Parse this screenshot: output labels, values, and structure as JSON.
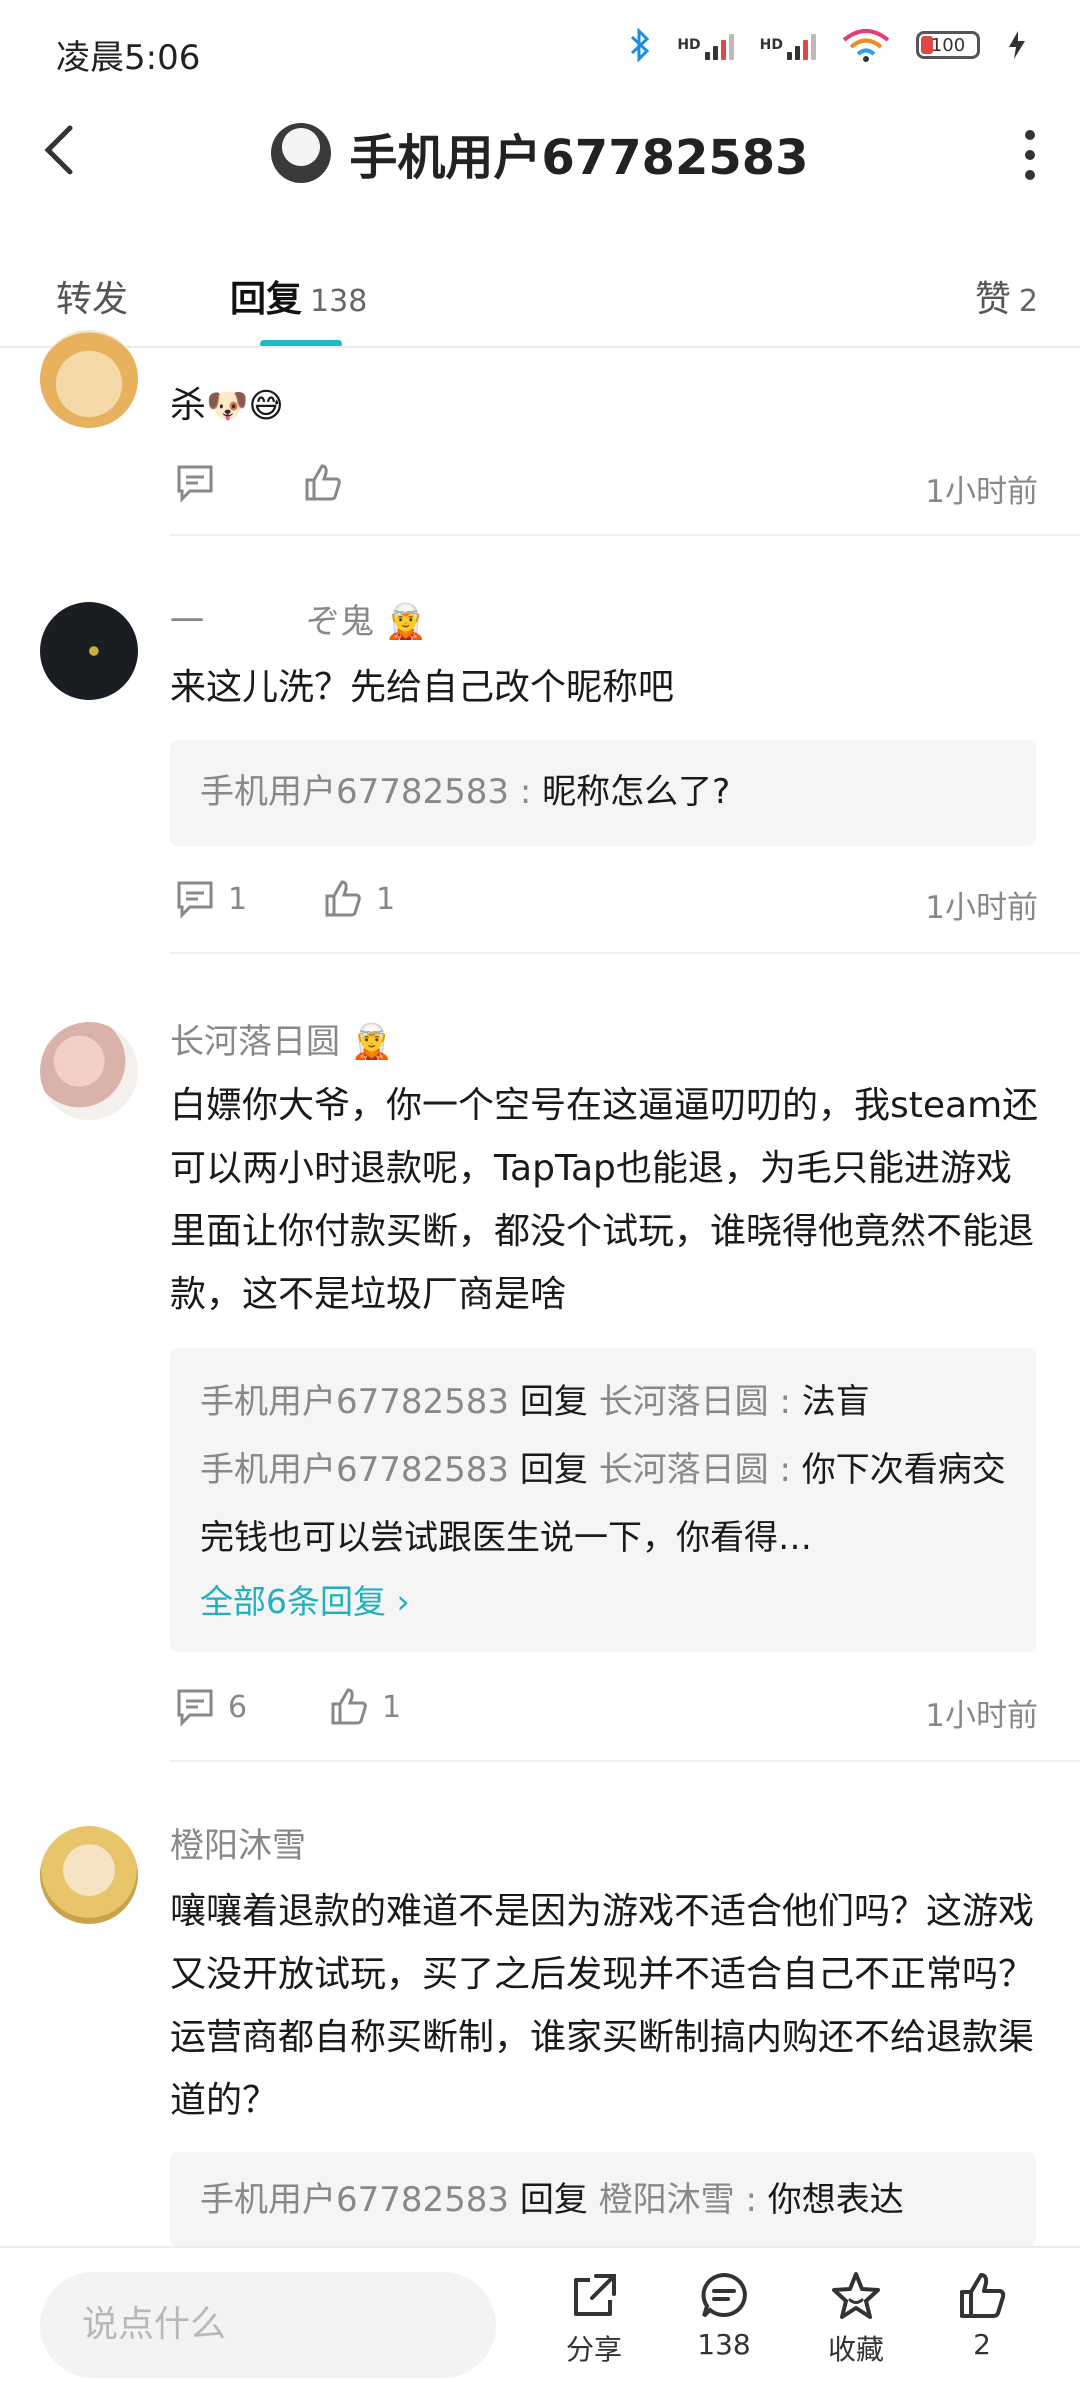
{
  "status_bar": {
    "time": "凌晨5:06",
    "battery": "100",
    "sim1": "HD",
    "sim2": "HD"
  },
  "header": {
    "title": "手机用户67782583"
  },
  "tabs": {
    "repost": "转发",
    "reply": "回复",
    "reply_count": "138",
    "likes": "赞",
    "likes_count": "2"
  },
  "comments": [
    {
      "username": "",
      "content": "杀",
      "content_emoji": "🐶😅",
      "time": "1小时前",
      "comment_count": "",
      "like_count": ""
    },
    {
      "username": "一　　　ぞ鬼",
      "content": "来这儿洗？先给自己改个昵称吧",
      "replies": [
        {
          "author": "手机用户67782583",
          "text": "昵称怎么了?"
        }
      ],
      "time": "1小时前",
      "comment_count": "1",
      "like_count": "1"
    },
    {
      "username": "长河落日圆",
      "content": "白嫖你大爷，你一个空号在这逼逼叨叨的，我steam还可以两小时退款呢，TapTap也能退，为毛只能进游戏里面让你付款买断，都没个试玩，谁晓得他竟然不能退款，这不是垃圾厂商是啥",
      "replies": [
        {
          "author": "手机用户67782583",
          "verb": "回复",
          "target": "长河落日圆",
          "text": "法盲"
        },
        {
          "author": "手机用户67782583",
          "verb": "回复",
          "target": "长河落日圆",
          "text": "你下次看病交完钱也可以尝试跟医生说一下，你看得…"
        }
      ],
      "view_all": "全部6条回复",
      "time": "1小时前",
      "comment_count": "6",
      "like_count": "1"
    },
    {
      "username": "橙阳沐雪",
      "content": "嚷嚷着退款的难道不是因为游戏不适合他们吗？这游戏又没开放试玩，买了之后发现并不适合自己不正常吗？运营商都自称买断制，谁家买断制搞内购还不给退款渠道的？",
      "replies": [
        {
          "author": "手机用户67782583",
          "verb": "回复",
          "target": "橙阳沐雪",
          "text": "你想表达"
        }
      ]
    }
  ],
  "bottom_bar": {
    "input_placeholder": "说点什么",
    "share": "分享",
    "comments": "138",
    "favorite": "收藏",
    "likes": "2"
  },
  "colors": {
    "accent": "#20b9c8",
    "muted": "#888888"
  }
}
